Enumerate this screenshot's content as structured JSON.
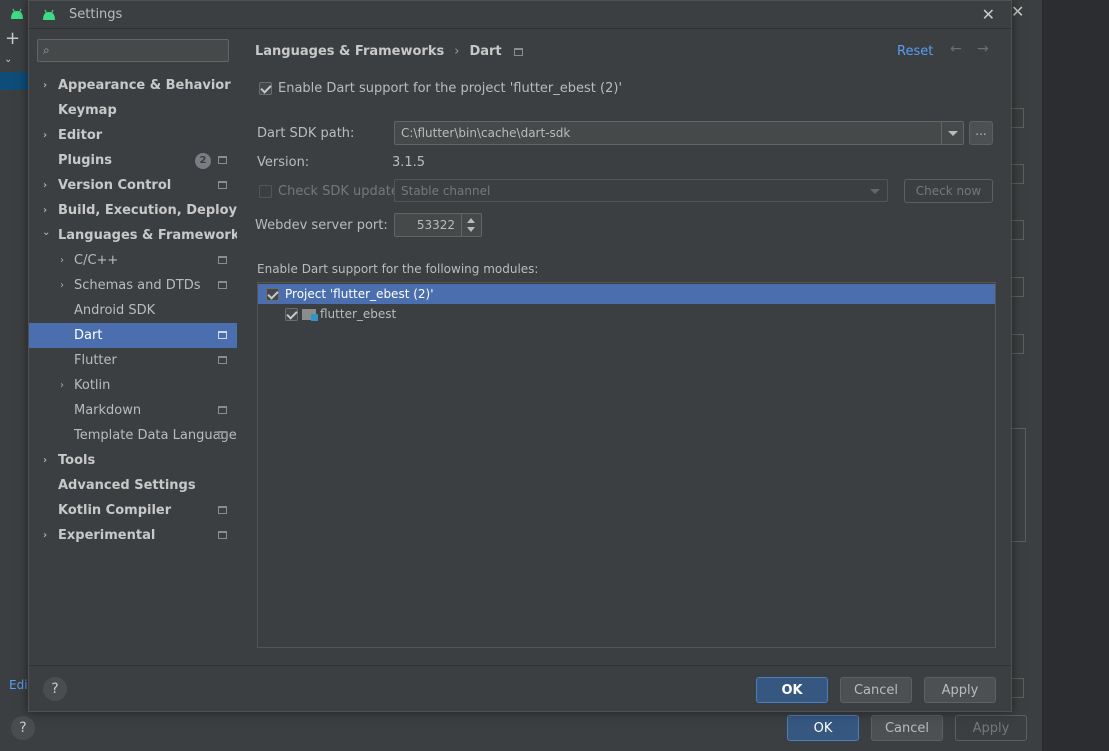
{
  "dialog": {
    "title": "Settings"
  },
  "sidebar": {
    "search_placeholder": "",
    "items": [
      {
        "label": "Appearance & Behavior",
        "chev": "›"
      },
      {
        "label": "Keymap"
      },
      {
        "label": "Editor",
        "chev": "›"
      },
      {
        "label": "Plugins",
        "badge": "2"
      },
      {
        "label": "Version Control",
        "chev": "›"
      },
      {
        "label": "Build, Execution, Deployment",
        "chev": "›"
      },
      {
        "label": "Languages & Frameworks",
        "chev": "⌄"
      },
      {
        "label": "C/C++",
        "chev": "›"
      },
      {
        "label": "Schemas and DTDs",
        "chev": "›"
      },
      {
        "label": "Android SDK"
      },
      {
        "label": "Dart"
      },
      {
        "label": "Flutter"
      },
      {
        "label": "Kotlin",
        "chev": "›"
      },
      {
        "label": "Markdown"
      },
      {
        "label": "Template Data Languages"
      },
      {
        "label": "Tools",
        "chev": "›"
      },
      {
        "label": "Advanced Settings"
      },
      {
        "label": "Kotlin Compiler"
      },
      {
        "label": "Experimental",
        "chev": "›"
      }
    ]
  },
  "content": {
    "breadcrumb": {
      "parent": "Languages & Frameworks",
      "sep": "›",
      "current": "Dart"
    },
    "reset_label": "Reset",
    "nav_back": "←",
    "nav_forward": "→",
    "enable_project_label": "Enable Dart support for the project 'flutter_ebest (2)'",
    "sdk_path_label": "Dart SDK path:",
    "sdk_path_value": "C:\\flutter\\bin\\cache\\dart-sdk",
    "browse_label": "...",
    "version_label": "Version:",
    "version_value": "3.1.5",
    "check_sdk_label": "Check SDK update:",
    "channel_value": "Stable channel",
    "check_now_label": "Check now",
    "port_label": "Webdev server port:",
    "port_value": "53322",
    "modules_label": "Enable Dart support for the following modules:",
    "modules": [
      {
        "label": "Project 'flutter_ebest (2)'"
      },
      {
        "label": "flutter_ebest"
      }
    ]
  },
  "footer": {
    "help": "?",
    "ok": "OK",
    "cancel": "Cancel",
    "apply": "Apply"
  },
  "background": {
    "edit": "Edit",
    "help": "?",
    "ok": "OK",
    "cancel": "Cancel",
    "apply": "Apply",
    "plus": "+",
    "close": "✕"
  },
  "colors": {
    "accent": "#4b6eaf",
    "link": "#589df6",
    "background": "#3c3f41",
    "primary_button": "#365880"
  }
}
